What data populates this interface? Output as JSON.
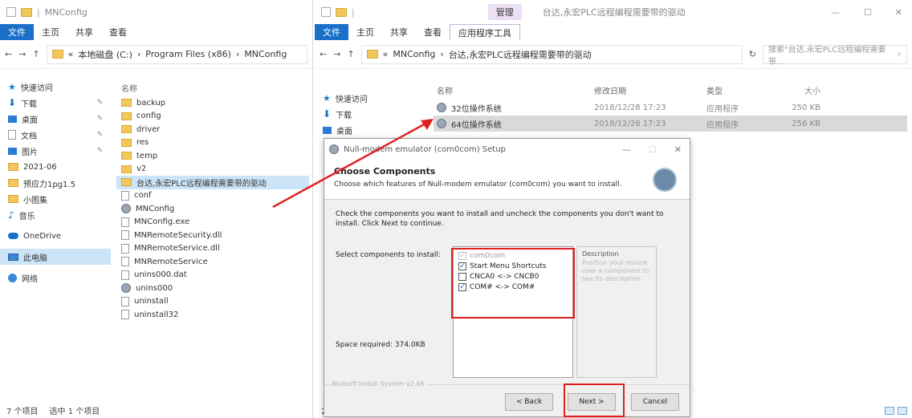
{
  "left_window": {
    "title": "MNConfig",
    "tabs": [
      "文件",
      "主页",
      "共享",
      "查看"
    ],
    "address": [
      "此电脑",
      "本地磁盘 (C:)",
      "Program Files (x86)",
      "MNConfig"
    ],
    "nav_items": [
      {
        "label": "快速访问",
        "icon": "star-icon"
      },
      {
        "label": "下载",
        "icon": "download-icon"
      },
      {
        "label": "桌面",
        "icon": "desktop-icon"
      },
      {
        "label": "文档",
        "icon": "document-icon"
      },
      {
        "label": "图片",
        "icon": "picture-icon"
      },
      {
        "label": "2021-06",
        "icon": "folder-icon"
      },
      {
        "label": "预应力1pg1.5",
        "icon": "folder-icon"
      },
      {
        "label": "小图集",
        "icon": "folder-icon"
      },
      {
        "label": "音乐",
        "icon": "music-icon"
      },
      {
        "label": "OneDrive",
        "icon": "cloud-icon"
      },
      {
        "label": "此电脑",
        "icon": "pc-icon"
      },
      {
        "label": "网络",
        "icon": "network-icon"
      }
    ],
    "column_name": "名称",
    "files": [
      {
        "name": "backup",
        "icon": "folder-icon"
      },
      {
        "name": "config",
        "icon": "folder-icon"
      },
      {
        "name": "driver",
        "icon": "folder-icon"
      },
      {
        "name": "res",
        "icon": "folder-icon"
      },
      {
        "name": "temp",
        "icon": "folder-icon"
      },
      {
        "name": "v2",
        "icon": "folder-icon"
      },
      {
        "name": "台达,永宏PLC远程编程需要带的驱动",
        "icon": "folder-icon"
      },
      {
        "name": "conf",
        "icon": "file-icon"
      },
      {
        "name": "MNConfig",
        "icon": "app-icon"
      },
      {
        "name": "MNConfig.exe",
        "icon": "file-icon"
      },
      {
        "name": "MNRemoteSecurity.dll",
        "icon": "file-icon"
      },
      {
        "name": "MNRemoteService.dll",
        "icon": "file-icon"
      },
      {
        "name": "MNRemoteService",
        "icon": "file-icon"
      },
      {
        "name": "unins000.dat",
        "icon": "file-icon"
      },
      {
        "name": "unins000",
        "icon": "app-icon"
      },
      {
        "name": "uninstall",
        "icon": "file-icon"
      },
      {
        "name": "uninstall32",
        "icon": "file-icon"
      }
    ],
    "status": {
      "count": "7 个项目",
      "selected": "选中 1 个项目"
    }
  },
  "right_window": {
    "title": "台达,永宏PLC远程编程需要带的驱动",
    "context_tab": "管理",
    "tabs": [
      "文件",
      "主页",
      "共享",
      "查看",
      "应用程序工具"
    ],
    "address": [
      "MNConfig",
      "台达,永宏PLC远程编程需要带的驱动"
    ],
    "search_placeholder": "搜索\"台达,永宏PLC远程编程需要带...",
    "nav_items": [
      {
        "label": "快速访问",
        "icon": "star-icon"
      },
      {
        "label": "下载",
        "icon": "download-icon"
      },
      {
        "label": "桌面",
        "icon": "desktop-icon"
      }
    ],
    "columns": {
      "name": "名称",
      "modified": "修改日期",
      "type": "类型",
      "size": "大小"
    },
    "rows": [
      {
        "name": "32位操作系统",
        "modified": "2018/12/28 17:23",
        "type": "应用程序",
        "size": "250 KB"
      },
      {
        "name": "64位操作系统",
        "modified": "2018/12/28 17:23",
        "type": "应用程序",
        "size": "256 KB"
      }
    ],
    "status": {
      "count": "2 个"
    }
  },
  "dialog": {
    "title": "Null-modem emulator (com0com) Setup",
    "heading": "Choose Components",
    "subheading": "Choose which features of Null-modem emulator (com0com) you want to install.",
    "instructions": "Check the components you want to install and uncheck the components you don't want to install. Click Next to continue.",
    "select_label": "Select components to install:",
    "components": [
      {
        "label": "com0com",
        "checked": true,
        "disabled": true
      },
      {
        "label": "Start Menu Shortcuts",
        "checked": true,
        "disabled": false
      },
      {
        "label": "CNCA0 <-> CNCB0",
        "checked": false,
        "disabled": false
      },
      {
        "label": "COM# <-> COM#",
        "checked": true,
        "disabled": false
      }
    ],
    "description_title": "Description",
    "description_hint": "Position your mouse over a component to see its description.",
    "space_required": "Space required: 374.0KB",
    "nsis": "Nullsoft Install System v2.46",
    "buttons": {
      "back": "< Back",
      "next": "Next >",
      "cancel": "Cancel"
    }
  },
  "colors": {
    "annotation": "#e02020",
    "selection": "#cce4f7",
    "accent": "#1a6fc9"
  }
}
